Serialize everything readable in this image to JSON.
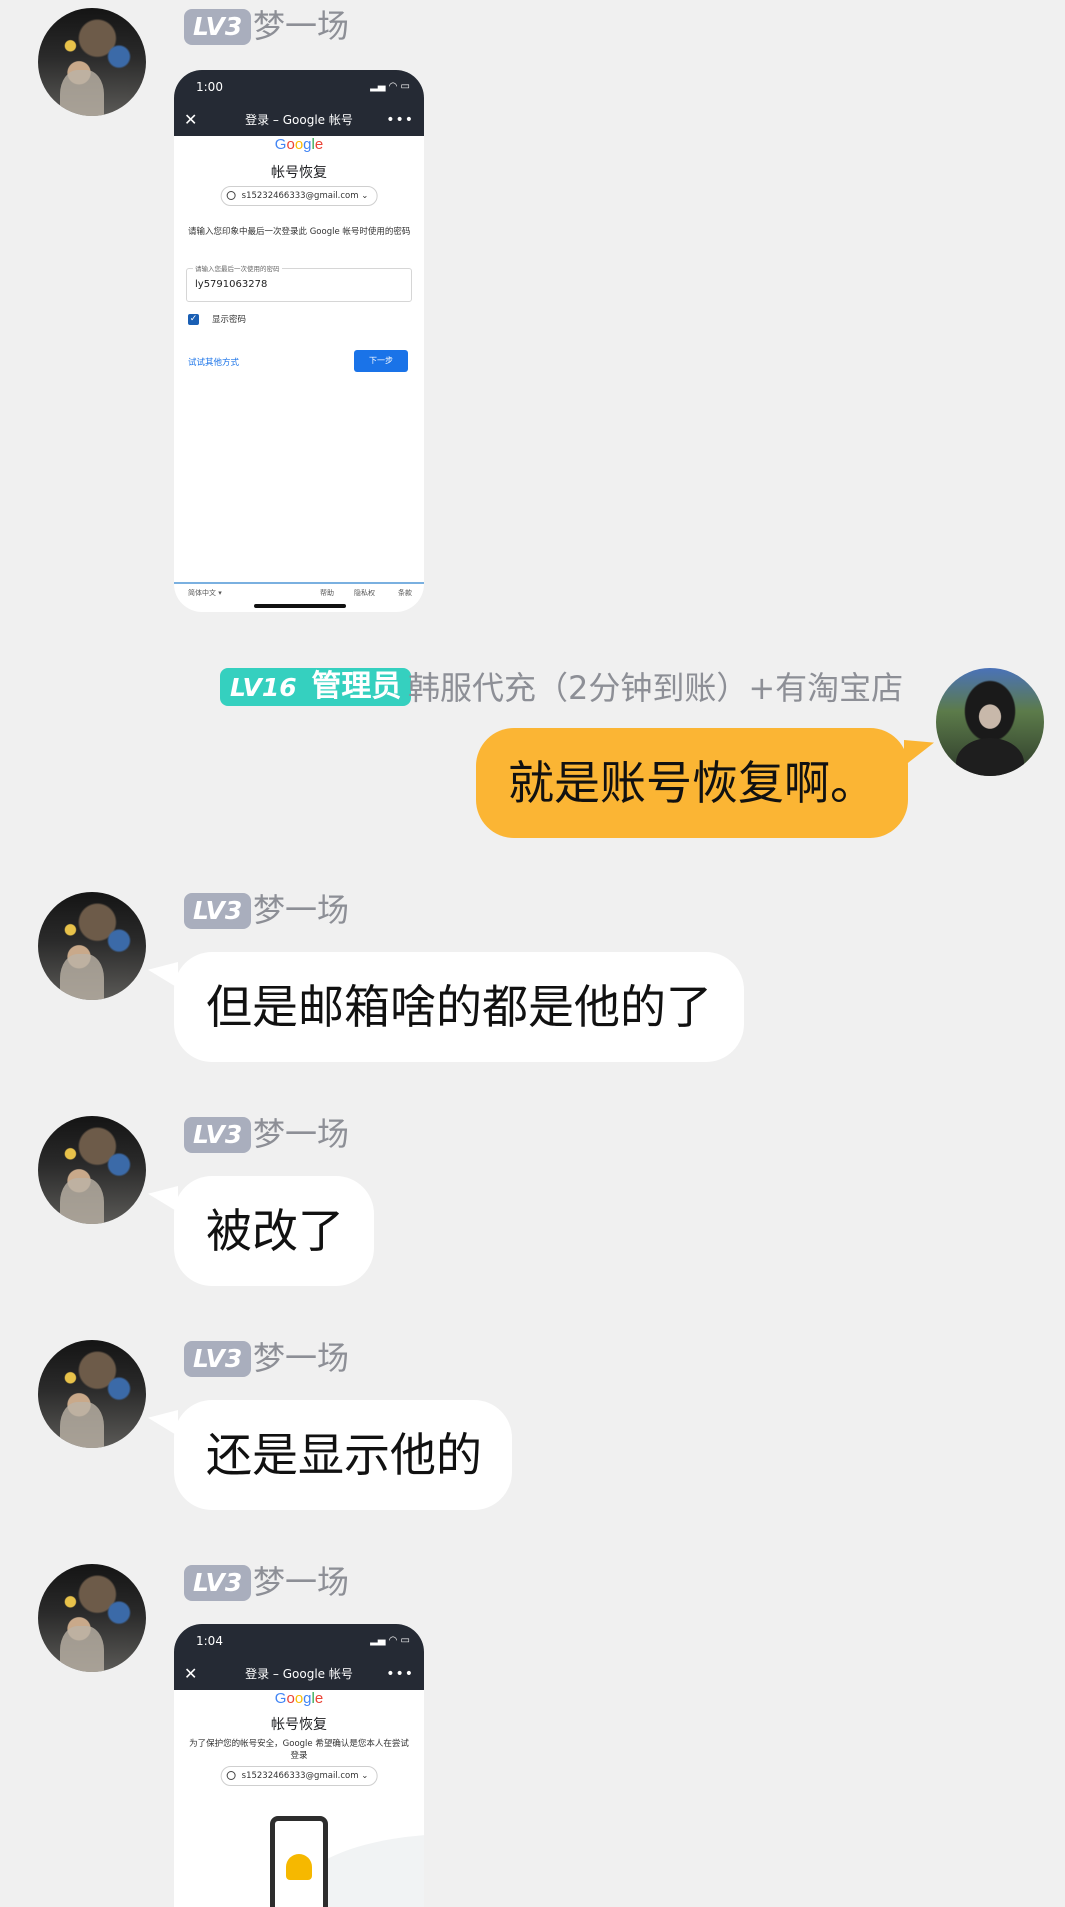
{
  "messages": [
    {
      "sender": "梦一场",
      "level": "LV3",
      "type": "image",
      "screenshot": {
        "time": "1:00",
        "page_title": "登录 – Google 帐号",
        "logo": "Google",
        "heading": "帐号恢复",
        "email": "s15232466333@gmail.com",
        "prompt": "请输入您印象中最后一次登录此 Google 帐号时使用的密码",
        "field_label": "请输入您最后一次使用的密码",
        "field_value": "ly5791063278",
        "checkbox_label": "显示密码",
        "try_other": "试试其他方式",
        "next": "下一步",
        "footer_lang": "简体中文",
        "footer_links": [
          "帮助",
          "隐私权",
          "条款"
        ]
      }
    },
    {
      "sender": "韩服代充（2分钟到账）+有淘宝店",
      "level": "LV16",
      "role": "管理员",
      "type": "text",
      "text": "就是账号恢复啊。"
    },
    {
      "sender": "梦一场",
      "level": "LV3",
      "type": "text",
      "text": "但是邮箱啥的都是他的了"
    },
    {
      "sender": "梦一场",
      "level": "LV3",
      "type": "text",
      "text": "被改了"
    },
    {
      "sender": "梦一场",
      "level": "LV3",
      "type": "text",
      "text": "还是显示他的"
    },
    {
      "sender": "梦一场",
      "level": "LV3",
      "type": "image",
      "screenshot": {
        "time": "1:04",
        "page_title": "登录 – Google 帐号",
        "logo": "Google",
        "heading": "帐号恢复",
        "subtitle": "为了保护您的帐号安全，Google 希望确认是您本人在尝试登录",
        "email": "s15232466333@gmail.com"
      }
    }
  ],
  "colors": {
    "background": "#f0f0f0",
    "bubble_self": "#fbb534",
    "bubble_other": "#ffffff",
    "badge_level": "#a9aebd",
    "badge_admin": "#35d0bf",
    "name_text": "#8d8f96"
  }
}
